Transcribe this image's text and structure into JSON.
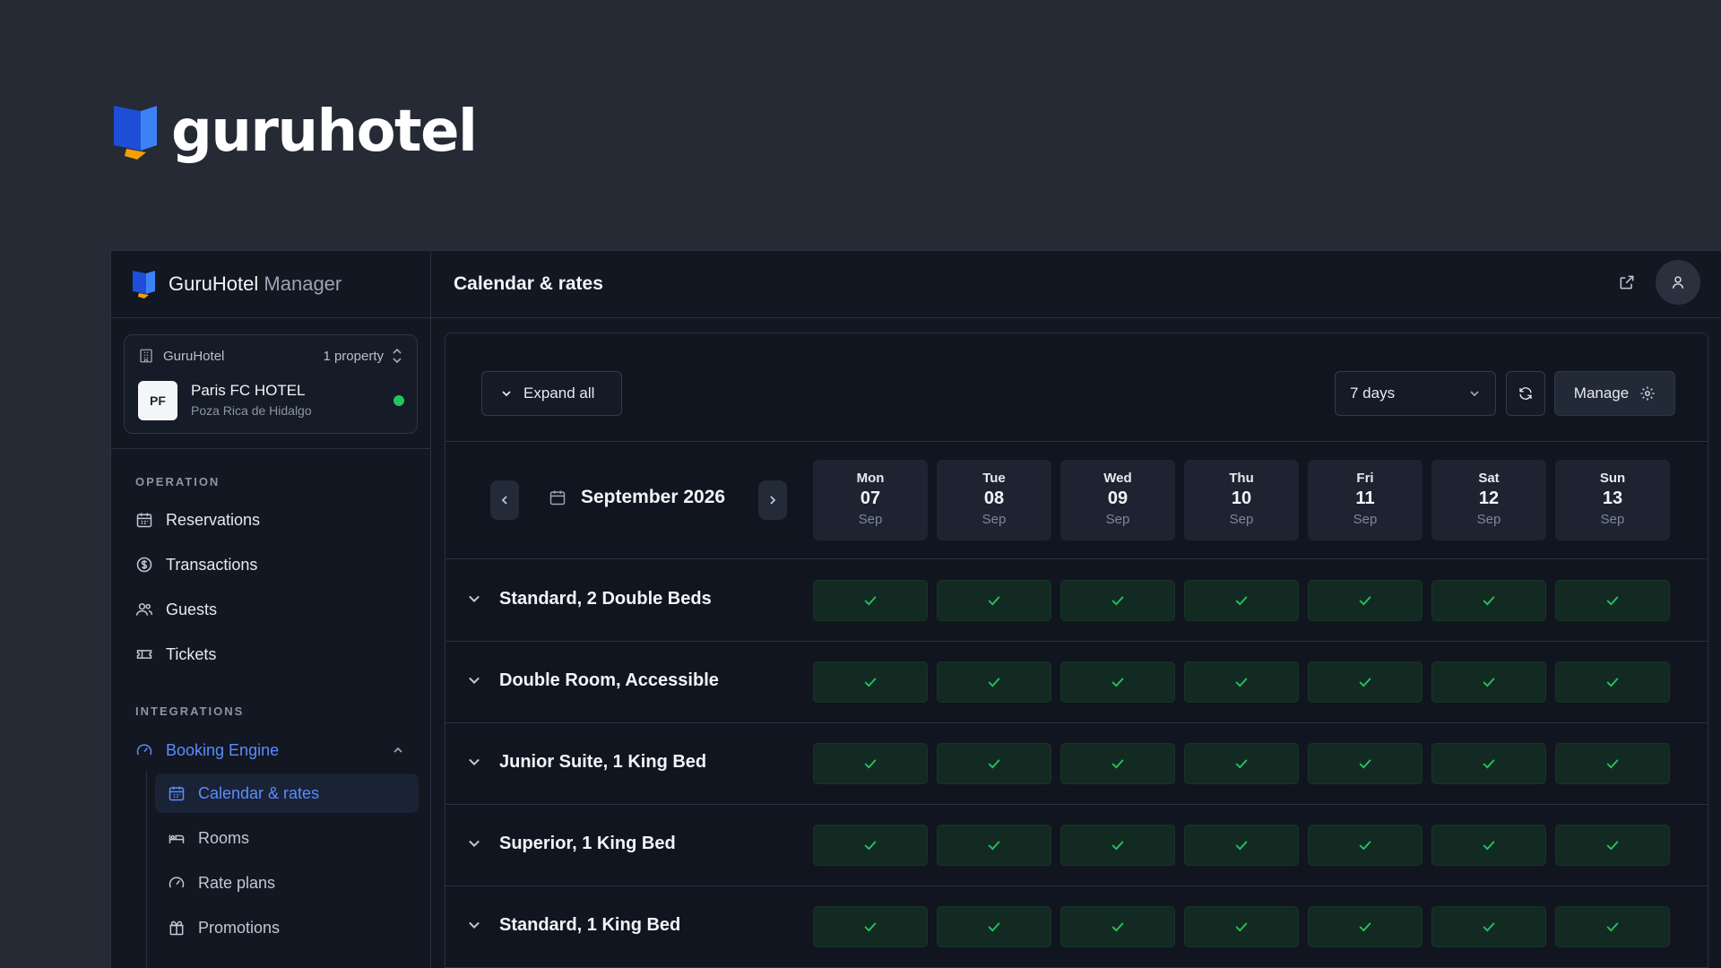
{
  "brand": {
    "name": "guruhotel"
  },
  "sidebar": {
    "app_name": "GuruHotel",
    "app_suffix": "Manager",
    "property": {
      "group": "GuruHotel",
      "count": "1 property",
      "initials": "PF",
      "name": "Paris FC HOTEL",
      "location": "Poza Rica de Hidalgo",
      "status_color": "#22c55e"
    },
    "operation_label": "OPERATION",
    "operation_items": [
      {
        "label": "Reservations",
        "icon": "calendar-icon"
      },
      {
        "label": "Transactions",
        "icon": "dollar-circle-icon"
      },
      {
        "label": "Guests",
        "icon": "users-icon"
      },
      {
        "label": "Tickets",
        "icon": "ticket-icon"
      }
    ],
    "integrations_label": "INTEGRATIONS",
    "booking_engine": {
      "label": "Booking Engine",
      "icon": "gauge-icon",
      "expanded": true
    },
    "booking_items": [
      {
        "label": "Calendar & rates",
        "icon": "calendar-icon",
        "active": true
      },
      {
        "label": "Rooms",
        "icon": "bed-icon"
      },
      {
        "label": "Rate plans",
        "icon": "gauge-icon"
      },
      {
        "label": "Promotions",
        "icon": "gift-icon"
      }
    ]
  },
  "header": {
    "title": "Calendar & rates"
  },
  "toolbar": {
    "expand_label": "Expand all",
    "range_value": "7 days",
    "manage_label": "Manage"
  },
  "calendar": {
    "month": "September 2026",
    "days": [
      {
        "name": "Mon",
        "num": "07",
        "month": "Sep"
      },
      {
        "name": "Tue",
        "num": "08",
        "month": "Sep"
      },
      {
        "name": "Wed",
        "num": "09",
        "month": "Sep"
      },
      {
        "name": "Thu",
        "num": "10",
        "month": "Sep"
      },
      {
        "name": "Fri",
        "num": "11",
        "month": "Sep"
      },
      {
        "name": "Sat",
        "num": "12",
        "month": "Sep"
      },
      {
        "name": "Sun",
        "num": "13",
        "month": "Sep"
      }
    ],
    "rooms": [
      {
        "name": "Standard, 2 Double Beds",
        "availability": [
          true,
          true,
          true,
          true,
          true,
          true,
          true
        ]
      },
      {
        "name": "Double Room, Accessible",
        "availability": [
          true,
          true,
          true,
          true,
          true,
          true,
          true
        ]
      },
      {
        "name": "Junior Suite, 1 King Bed",
        "availability": [
          true,
          true,
          true,
          true,
          true,
          true,
          true
        ]
      },
      {
        "name": "Superior, 1 King Bed",
        "availability": [
          true,
          true,
          true,
          true,
          true,
          true,
          true
        ]
      },
      {
        "name": "Standard, 1 King Bed",
        "availability": [
          true,
          true,
          true,
          true,
          true,
          true,
          true
        ]
      }
    ]
  },
  "colors": {
    "accent": "#5b8cff",
    "available": "#22c55e",
    "background": "#252a35"
  }
}
